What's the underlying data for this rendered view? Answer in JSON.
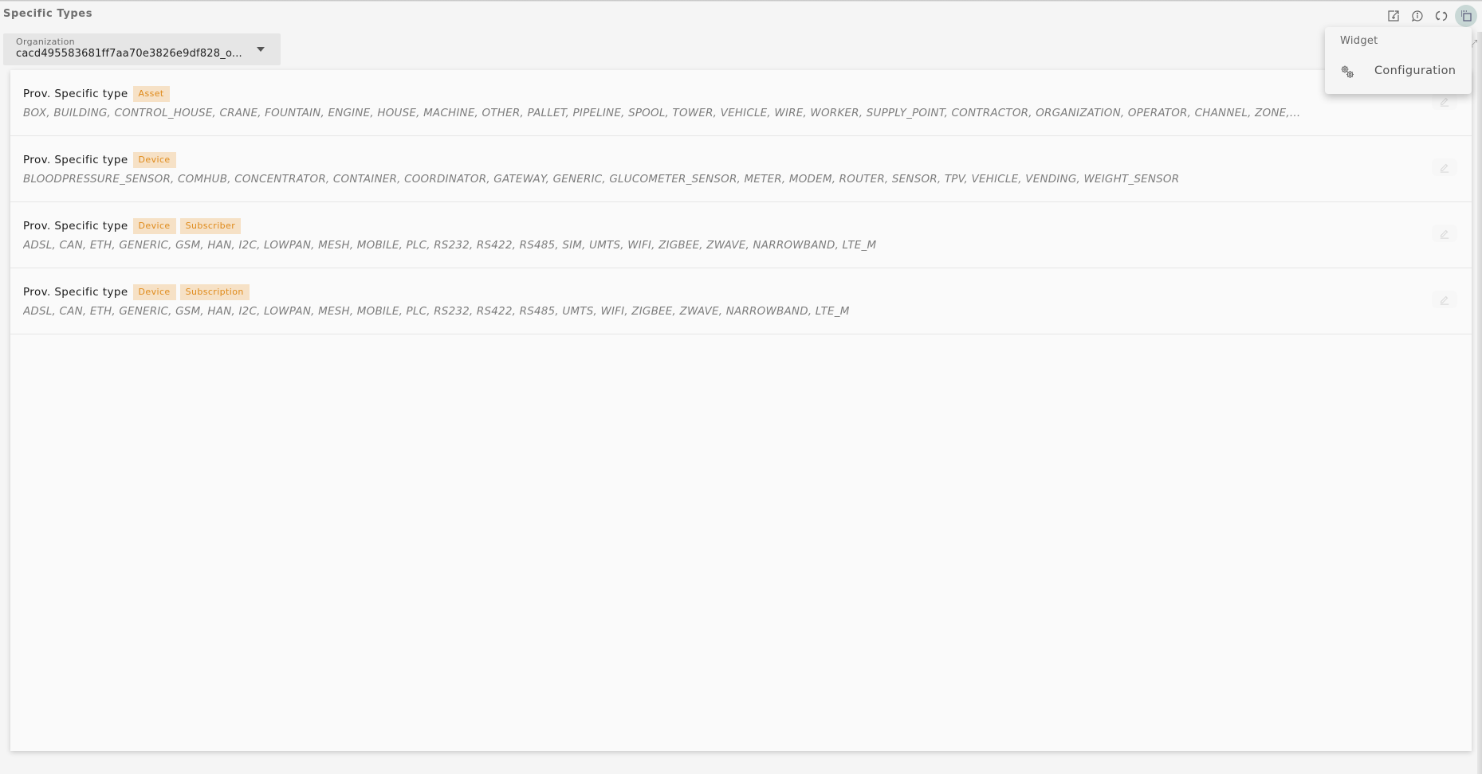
{
  "widget": {
    "title": "Specific Types",
    "header_icons": [
      "export-icon",
      "info-icon",
      "refresh-icon",
      "widget-menu-icon"
    ]
  },
  "organization": {
    "label": "Organization",
    "value": "cacd495583681ff7aa70e3826e9df828_o..."
  },
  "rows": [
    {
      "title": "Prov. Specific type",
      "badges": [
        "Asset"
      ],
      "description": "BOX, BUILDING, CONTROL_HOUSE, CRANE, FOUNTAIN, ENGINE, HOUSE, MACHINE, OTHER, PALLET, PIPELINE, SPOOL, TOWER, VEHICLE, WIRE, WORKER, SUPPLY_POINT, CONTRACTOR, ORGANIZATION, OPERATOR, CHANNEL, ZONE,..."
    },
    {
      "title": "Prov. Specific type",
      "badges": [
        "Device"
      ],
      "description": "BLOODPRESSURE_SENSOR, COMHUB, CONCENTRATOR, CONTAINER, COORDINATOR, GATEWAY, GENERIC, GLUCOMETER_SENSOR, METER, MODEM, ROUTER, SENSOR, TPV, VEHICLE, VENDING, WEIGHT_SENSOR"
    },
    {
      "title": "Prov. Specific type",
      "badges": [
        "Device",
        "Subscriber"
      ],
      "description": "ADSL, CAN, ETH, GENERIC, GSM, HAN, I2C, LOWPAN, MESH, MOBILE, PLC, RS232, RS422, RS485, SIM, UMTS, WIFI, ZIGBEE, ZWAVE, NARROWBAND, LTE_M"
    },
    {
      "title": "Prov. Specific type",
      "badges": [
        "Device",
        "Subscription"
      ],
      "description": "ADSL, CAN, ETH, GENERIC, GSM, HAN, I2C, LOWPAN, MESH, MOBILE, PLC, RS232, RS422, RS485, UMTS, WIFI, ZIGBEE, ZWAVE, NARROWBAND, LTE_M"
    }
  ],
  "popup_menu": {
    "heading": "Widget",
    "items": [
      {
        "label": "Configuration",
        "icon": "gears-icon"
      }
    ]
  },
  "colors": {
    "badge_bg": "#f6e1c6",
    "badge_text": "#df8a1a",
    "active_icon_bg": "#c9d8d6"
  }
}
